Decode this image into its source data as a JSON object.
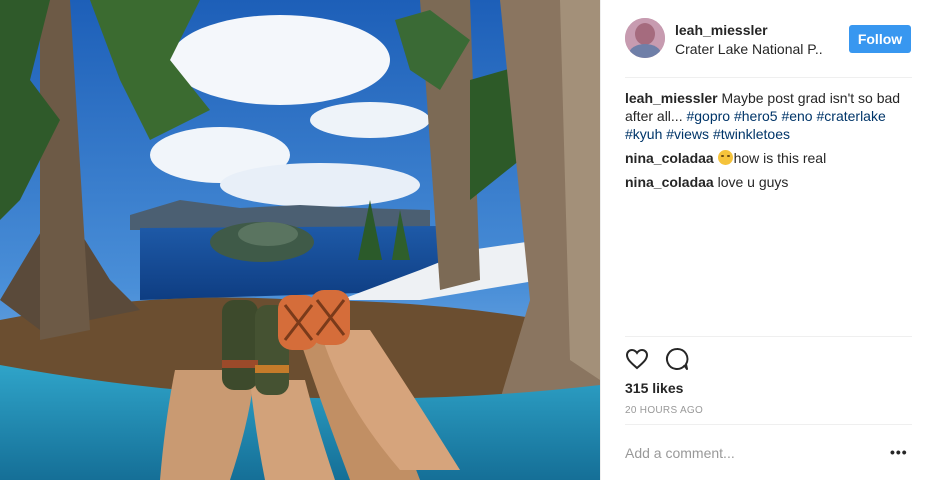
{
  "post": {
    "username": "leah_miessler",
    "location": "Crater Lake National P..",
    "follow_label": "Follow",
    "caption_user": "leah_miessler",
    "caption_text": "Maybe post grad isn't so bad after all...",
    "hashtags": [
      "#gopro",
      "#hero5",
      "#eno",
      "#craterlake",
      "#kyuh",
      "#views",
      "#twinkletoes"
    ],
    "comments": [
      {
        "user": "nina_coladaa",
        "emoji": "weary-face-emoji",
        "text": "how is this real"
      },
      {
        "user": "nina_coladaa",
        "text": "love u guys"
      }
    ],
    "likes": "315 likes",
    "timestamp": "20 HOURS AGO",
    "add_comment_placeholder": "Add a comment...",
    "more_label": "•••"
  },
  "icons": {
    "like": "heart-icon",
    "comment": "comment-icon"
  },
  "colors": {
    "follow_button": "#3897f0",
    "hashtag": "#003569",
    "muted": "#999999"
  }
}
